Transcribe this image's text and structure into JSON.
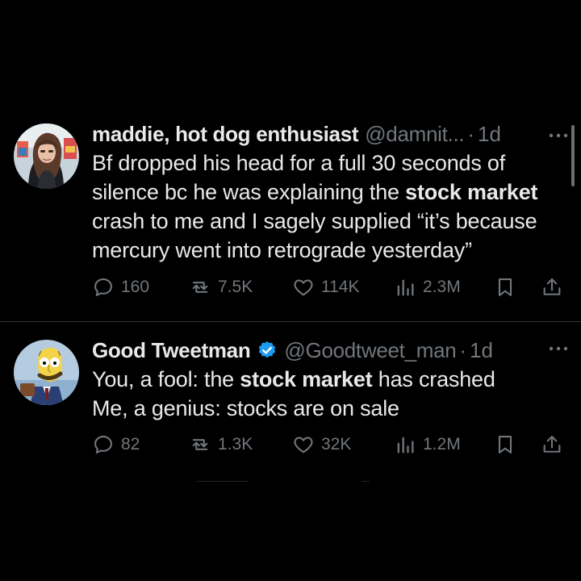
{
  "tweets": [
    {
      "display_name": "maddie, hot dog enthusiast",
      "handle": "@damnit...",
      "dot": "·",
      "time": "1d",
      "text_parts": [
        "Bf dropped his head for a full 30 seconds of silence bc he was explaining the ",
        "stock market",
        " crash to me and I sagely supplied “it’s because mercury went into retrograde yesterday”"
      ],
      "replies": "160",
      "retweets": "7.5K",
      "likes": "114K",
      "views": "2.3M",
      "verified": false,
      "avatar_icon": "avatar-photo"
    },
    {
      "display_name": "Good Tweetman",
      "handle": "@Goodtweet_man",
      "dot": "·",
      "time": "1d",
      "text_parts": [
        "You, a fool: the ",
        "stock market",
        " has crashed",
        "Me, a genius: stocks are on sale"
      ],
      "replies": "82",
      "retweets": "1.3K",
      "likes": "32K",
      "views": "1.2M",
      "verified": true,
      "avatar_icon": "mr-burns-cartoon-avatar"
    }
  ],
  "colors": {
    "background": "#000000",
    "primary_text": "#e7e9ea",
    "secondary_text": "#71767b",
    "verified_blue": "#1d9bf0",
    "divider": "#2f3336"
  }
}
